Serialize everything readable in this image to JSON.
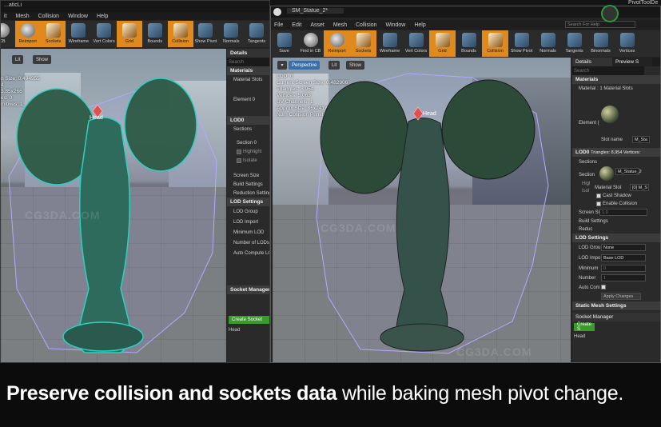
{
  "left_window": {
    "tab_title": "...aticLi",
    "menu": [
      "it",
      "Mesh",
      "Collision",
      "Window",
      "Help"
    ],
    "toolbar": [
      {
        "label": "CB",
        "icon": "find-in-cb-icon"
      },
      {
        "label": "Reimport",
        "icon": "reimport-icon",
        "active": true
      },
      {
        "label": "Sockets",
        "icon": "sockets-icon",
        "active": true
      },
      {
        "label": "Wireframe",
        "icon": "wireframe-icon"
      },
      {
        "label": "Vert Colors",
        "icon": "vert-colors-icon"
      },
      {
        "label": "Grid",
        "icon": "grid-icon",
        "active": true
      },
      {
        "label": "Bounds",
        "icon": "bounds-icon"
      },
      {
        "label": "Collision",
        "icon": "collision-icon",
        "active": true
      },
      {
        "label": "Show Pivot",
        "icon": "show-pivot-icon"
      },
      {
        "label": "Normals",
        "icon": "normals-icon"
      },
      {
        "label": "Tangents",
        "icon": "tangents-icon"
      }
    ],
    "viewport_buttons": {
      "lit": "Lit",
      "show": "Show"
    },
    "stats": [
      "n Size: 0.494955",
      "",
      "",
      "4",
      "3.85x266",
      "es: 0",
      "mitives: 1"
    ],
    "socket_label": "Head",
    "details_tab": "Details",
    "search_placeholder": "Search",
    "materials_header": "Materials",
    "material_slots_label": "Material Slots",
    "element0_label": "Element 0",
    "lod0_header": "LOD0",
    "sections_label": "Sections",
    "section0_label": "Section 0",
    "highlight_label": "Highlight",
    "isolate_label": "Isolate",
    "screen_size_label": "Screen Size",
    "build_settings_label": "Build Settings",
    "reduction_settings_label": "Reduction Settings",
    "lod_settings_header": "LOD Settings",
    "lod_group_label": "LOD Group",
    "lod_import_label": "LOD Import",
    "minimum_lod_label": "Minimum LOD",
    "number_of_lods_label": "Number of LODs",
    "auto_compute_label": "Auto Compute LOD",
    "socket_manager_label": "Socket Manager",
    "create_socket_label": "Create Socket",
    "socket_list_item": "Head"
  },
  "right_window": {
    "tab_title": "SM_Statue_2*",
    "menu": [
      "File",
      "Edit",
      "Asset",
      "Mesh",
      "Collision",
      "Window",
      "Help"
    ],
    "search_help": "Search For Help",
    "toolbar": [
      {
        "label": "Save",
        "icon": "save-icon"
      },
      {
        "label": "Find in CB",
        "icon": "find-in-cb-icon"
      },
      {
        "label": "Reimport",
        "icon": "reimport-icon",
        "active": true
      },
      {
        "label": "Sockets",
        "icon": "sockets-icon",
        "active": true
      },
      {
        "label": "Wireframe",
        "icon": "wireframe-icon"
      },
      {
        "label": "Vert Colors",
        "icon": "vert-colors-icon"
      },
      {
        "label": "Grid",
        "icon": "grid-icon",
        "active": true
      },
      {
        "label": "Bounds",
        "icon": "bounds-icon"
      },
      {
        "label": "Collision",
        "icon": "collision-icon",
        "active": true
      },
      {
        "label": "Show Pivot",
        "icon": "show-pivot-icon"
      },
      {
        "label": "Normals",
        "icon": "normals-icon"
      },
      {
        "label": "Tangents",
        "icon": "tangents-icon"
      },
      {
        "label": "Binormals",
        "icon": "binormals-icon"
      },
      {
        "label": "Vertices",
        "icon": "vertices-icon"
      }
    ],
    "viewport_buttons": {
      "perspective": "Perspective",
      "lit": "Lit",
      "show": "Show"
    },
    "stats": [
      "LOD: 0",
      "Current Screen Size: 0.482906",
      "Triangles: 8,954",
      "Vertices: 5,063",
      "UV Channels: 1",
      "Approx Size: 86x241x266",
      "Num Collision Primitives: 1"
    ],
    "socket_label": "Head",
    "details_tab": "Details",
    "preview_tab": "Preview S",
    "search_placeholder": "Search",
    "materials_header": "Materials",
    "material_count": "Material : 1 Material Slots",
    "element_label": "Element (",
    "slot_name_label": "Slot name",
    "slot_name_value": "M_Sta",
    "lod0_header": "LOD0",
    "lod0_info": "Triangles: 8,954  Vertices:",
    "sections_label": "Sections",
    "section_label": "Section",
    "section_mat": "M_Statue_2",
    "material_slot_label": "Material Slot",
    "material_slot_value": "[0] M_S",
    "cast_shadow_label": "Cast Shadow",
    "enable_collision_label": "Enable Collision",
    "highlight_label": "Higl",
    "isolate_label": "Isol",
    "screen_size_label": "Screen Si",
    "screen_size_value": "1.0",
    "build_settings_label": "Build Settings",
    "reduction_label": "Reduc",
    "lod_settings_header": "LOD Settings",
    "lod_group_label": "LOD Grou",
    "lod_group_value": "None",
    "lod_import_label": "LOD Impo",
    "lod_import_value": "Base LOD",
    "minimum_label": "Minimum",
    "minimum_value": "0",
    "number_label": "Number",
    "number_value": "1",
    "auto_compute_label": "Auto Com",
    "apply_changes_label": "Apply Changes",
    "static_mesh_settings_header": "Static Mesh Settings",
    "socket_manager_label": "Socket Manager",
    "create_socket_label": "Create S",
    "socket_list_item": "Head",
    "top_right_text": "PivotToolDe"
  },
  "watermark": "CG3DA.COM",
  "caption": {
    "bold": "Preserve collision and sockets data",
    "rest": " while baking mesh pivot change."
  }
}
